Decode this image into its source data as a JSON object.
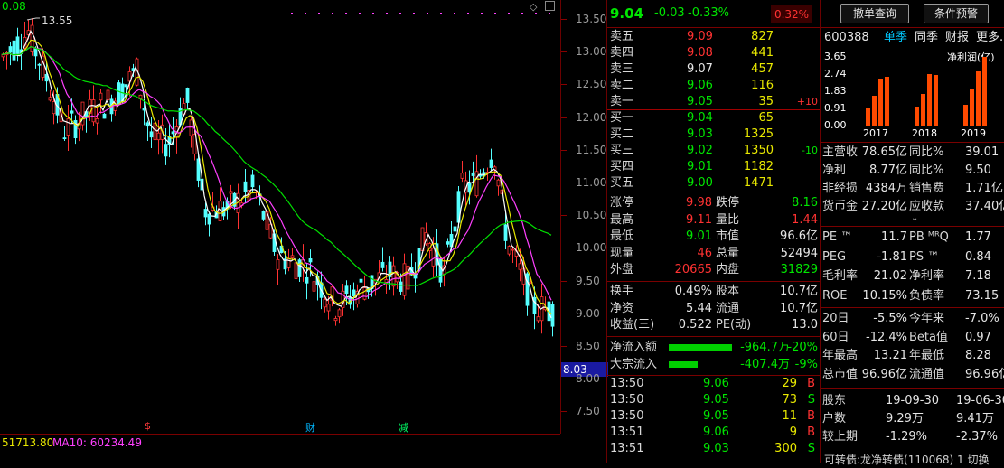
{
  "chart": {
    "max_price": "13.55",
    "top_left_value": "0.08",
    "current_price_tag": "8.03",
    "axis_ticks": [
      "13.50",
      "13.00",
      "12.50",
      "12.00",
      "11.50",
      "11.00",
      "10.50",
      "10.00",
      "9.50",
      "9.00",
      "8.50",
      "8.00",
      "7.50"
    ],
    "bottom_ma_text": "51713.80",
    "bottom_ma10_text": "MA10: 60234.49",
    "markers": [
      "$",
      "财",
      "减"
    ]
  },
  "quote": {
    "price": "9.04",
    "change": "-0.03",
    "change_pct": "-0.33%",
    "badge": "0.32%",
    "sell": [
      {
        "label": "卖五",
        "price": "9.09",
        "vol": "827",
        "delta": ""
      },
      {
        "label": "卖四",
        "price": "9.08",
        "vol": "441",
        "delta": ""
      },
      {
        "label": "卖三",
        "price": "9.07",
        "vol": "457",
        "delta": ""
      },
      {
        "label": "卖二",
        "price": "9.06",
        "vol": "116",
        "delta": ""
      },
      {
        "label": "卖一",
        "price": "9.05",
        "vol": "35",
        "delta": "+10"
      }
    ],
    "buy": [
      {
        "label": "买一",
        "price": "9.04",
        "vol": "65",
        "delta": ""
      },
      {
        "label": "买二",
        "price": "9.03",
        "vol": "1325",
        "delta": ""
      },
      {
        "label": "买三",
        "price": "9.02",
        "vol": "1350",
        "delta": "-10"
      },
      {
        "label": "买四",
        "price": "9.01",
        "vol": "1182",
        "delta": ""
      },
      {
        "label": "买五",
        "price": "9.00",
        "vol": "1471",
        "delta": ""
      }
    ],
    "stats": [
      {
        "l1": "涨停",
        "v1": "9.98",
        "l2": "跌停",
        "v2": "8.16"
      },
      {
        "l1": "最高",
        "v1": "9.11",
        "l2": "量比",
        "v2": "1.44"
      },
      {
        "l1": "最低",
        "v1": "9.01",
        "l2": "市值",
        "v2": "96.6亿"
      },
      {
        "l1": "现量",
        "v1": "46",
        "l2": "总量",
        "v2": "52494"
      },
      {
        "l1": "外盘",
        "v1": "20665",
        "l2": "内盘",
        "v2": "31829"
      }
    ],
    "stats2": [
      {
        "l1": "换手",
        "v1": "0.49%",
        "l2": "股本",
        "v2": "10.7亿"
      },
      {
        "l1": "净资",
        "v1": "5.44",
        "l2": "流通",
        "v2": "10.7亿"
      },
      {
        "l1": "收益(三)",
        "v1": "0.522",
        "l2": "PE(动)",
        "v2": "13.0"
      }
    ],
    "flow": [
      {
        "label": "净流入额",
        "value": "-964.7万",
        "pct": "-20%",
        "fill": 0.2
      },
      {
        "label": "大宗流入",
        "value": "-407.4万",
        "pct": "-9%",
        "fill": 0.09
      }
    ],
    "ticks": [
      {
        "time": "13:50",
        "price": "9.06",
        "vol": "29",
        "side": "B"
      },
      {
        "time": "13:50",
        "price": "9.05",
        "vol": "73",
        "side": "S"
      },
      {
        "time": "13:50",
        "price": "9.05",
        "vol": "11",
        "side": "B"
      },
      {
        "time": "13:51",
        "price": "9.06",
        "vol": "9",
        "side": "B"
      },
      {
        "time": "13:51",
        "price": "9.03",
        "vol": "300",
        "side": "S"
      }
    ]
  },
  "fund": {
    "btn_cancel": "撤单查询",
    "btn_alert": "条件预警",
    "code": "600388",
    "tabs": [
      "单季",
      "同季",
      "财报",
      "更多."
    ],
    "profit_label": "净利润(亿)",
    "y_ticks": [
      "3.65",
      "2.74",
      "1.83",
      "0.91",
      "0.00"
    ],
    "years": [
      "2017",
      "2018",
      "2019"
    ],
    "profit_values": [
      [
        0.91,
        1.6,
        2.5,
        2.6
      ],
      [
        1.0,
        1.7,
        2.74,
        2.7
      ],
      [
        1.1,
        1.9,
        2.9,
        3.65
      ]
    ],
    "rows": [
      {
        "l1": "主营收",
        "v1": "78.65亿",
        "l2": "同比%",
        "v2": "39.01"
      },
      {
        "l1": "净利",
        "v1": "8.77亿",
        "l2": "同比%",
        "v2": "9.50"
      },
      {
        "l1": "非经损",
        "v1": "4384万",
        "l2": "销售费",
        "v2": "1.71亿"
      },
      {
        "l1": "货币金",
        "v1": "27.20亿",
        "l2": "应收款",
        "v2": "37.40亿"
      }
    ],
    "rows2": [
      {
        "l1": "PE ™",
        "v1": "11.7",
        "l2": "PB ᴹᴿQ",
        "v2": "1.77"
      },
      {
        "l1": "PEG",
        "v1": "-1.81",
        "l2": "PS ™",
        "v2": "0.84"
      },
      {
        "l1": "毛利率",
        "v1": "21.02",
        "l2": "净利率",
        "v2": "7.18"
      },
      {
        "l1": "ROE",
        "v1": "10.15%",
        "l2": "负债率",
        "v2": "73.15"
      }
    ],
    "rows3": [
      {
        "l1": "20日",
        "v1": "-5.5%",
        "l2": "今年来",
        "v2": "-7.0%"
      },
      {
        "l1": "60日",
        "v1": "-12.4%",
        "l2": "Beta值",
        "v2": "0.97"
      },
      {
        "l1": "年最高",
        "v1": "13.21",
        "l2": "年最低",
        "v2": "8.28"
      },
      {
        "l1": "总市值",
        "v1": "96.96亿",
        "l2": "流通值",
        "v2": "96.96亿"
      }
    ],
    "holders": [
      {
        "l1": "股东",
        "v1": "19-09-30",
        "v2": "19-06-30"
      },
      {
        "l1": "户数",
        "v1": "9.29万",
        "v2": "9.41万"
      },
      {
        "l1": "较上期",
        "v1": "-1.29%",
        "v2": "-2.37%"
      }
    ],
    "footer": "可转债:龙净转债(110068) 1 切换"
  }
}
